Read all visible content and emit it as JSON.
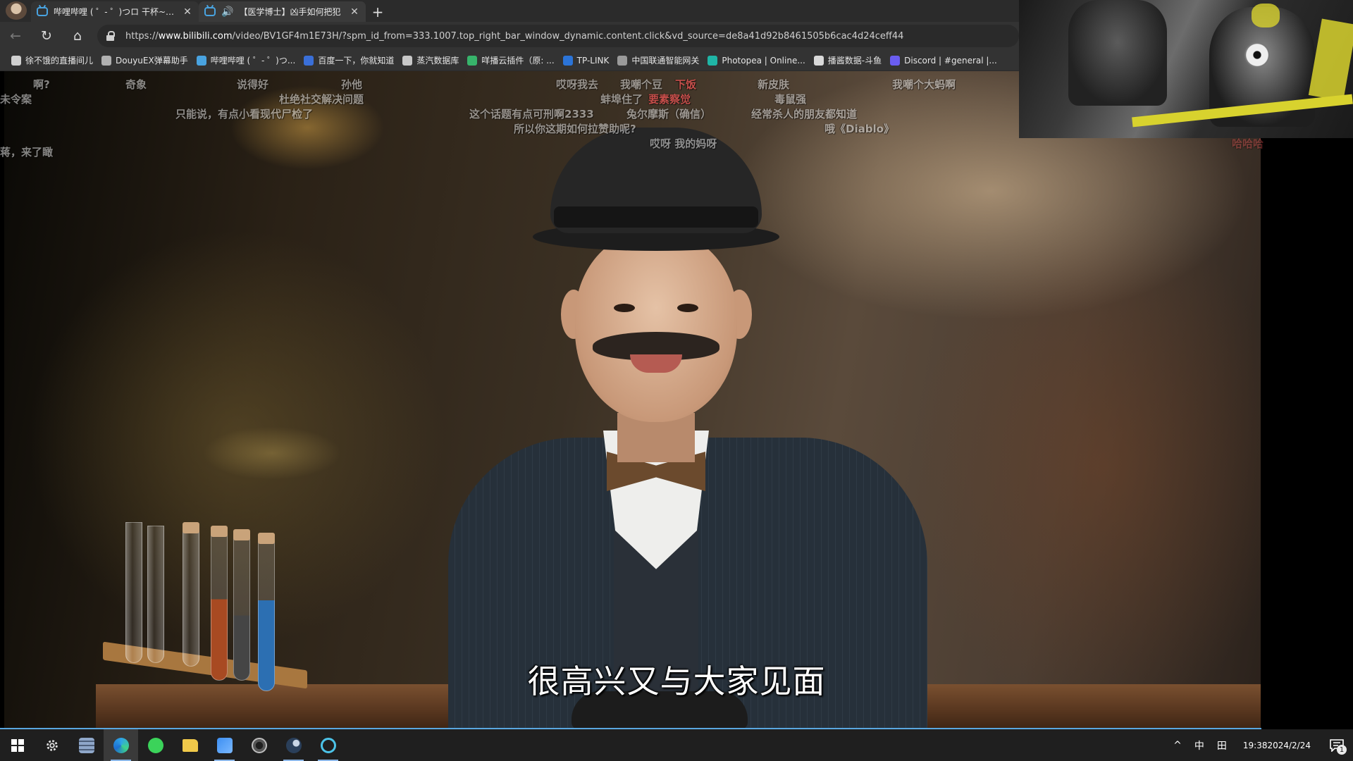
{
  "browser": {
    "tabs": [
      {
        "label": "哔哩哔哩 ( ゜- ゜)つロ 干杯~-bilil",
        "close": "✕"
      },
      {
        "label": "【医学博士】凶手如何把犯",
        "close": "✕"
      }
    ],
    "new_tab": "+",
    "icons": {
      "profile": "profile-avatar",
      "tab_favicon": "bilibili-tv-icon",
      "audio": "speaker-icon",
      "back": "arrow-left-icon",
      "reload": "reload-icon",
      "home": "home-icon",
      "lock": "lock-icon"
    },
    "nav": {
      "back": "←",
      "reload": "↻",
      "home": "⌂",
      "speaker": "🔊"
    },
    "url": {
      "scheme": "https://",
      "host": "www.bilibili.com",
      "path": "/video/BV1GF4m1E73H/?spm_id_from=333.1007.top_right_bar_window_dynamic.content.click&vd_source=de8a41d92b8461505b6cac4d24ceff44"
    },
    "bookmarks": [
      {
        "label": "徐不饿的直播间儿",
        "color": "#d0d0d0"
      },
      {
        "label": "DouyuEX弹幕助手",
        "color": "#b0b0b0"
      },
      {
        "label": "哔哩哔哩 ( ゜- ゜)つ...",
        "color": "#49a3e0"
      },
      {
        "label": "百度一下，你就知道",
        "color": "#3a6fd8"
      },
      {
        "label": "蒸汽数据库",
        "color": "#c8c8c8"
      },
      {
        "label": "咩播云插件（原: ...",
        "color": "#37b46b"
      },
      {
        "label": "TP-LINK",
        "color": "#2b74d8"
      },
      {
        "label": "中国联通智能网关",
        "color": "#9a9a9a"
      },
      {
        "label": "Photopea | Online...",
        "color": "#1fb5a6"
      },
      {
        "label": "播酱数据-斗鱼",
        "color": "#d9d9d9"
      },
      {
        "label": "Discord | #general |...",
        "color": "#6a5df0"
      }
    ]
  },
  "video": {
    "subtitle": "很高兴又与大家见面",
    "danmaku": [
      {
        "text": "啊?",
        "red": false
      },
      {
        "text": "奇象",
        "red": false
      },
      {
        "text": "说得好",
        "red": false
      },
      {
        "text": "孙他",
        "red": false
      },
      {
        "text": "哎呀我去",
        "red": false
      },
      {
        "text": "我嘲个豆",
        "red": false
      },
      {
        "text": "下饭",
        "red": true
      },
      {
        "text": "新皮肤",
        "red": false
      },
      {
        "text": "我嘲个大蚂啊",
        "red": false
      },
      {
        "text": "未令案",
        "red": false
      },
      {
        "text": "杜绝社交解决问题",
        "red": false
      },
      {
        "text": "蚌埠住了",
        "red": false
      },
      {
        "text": "要素察觉",
        "red": true
      },
      {
        "text": "毒鼠强",
        "red": false
      },
      {
        "text": "只能说，有点小看现代尸检了",
        "red": false
      },
      {
        "text": "这个话题有点可刑啊2333",
        "red": false
      },
      {
        "text": "兔尔摩斯（确信）",
        "red": false
      },
      {
        "text": "经常杀人的朋友都知道",
        "red": false
      },
      {
        "text": "所以你这期如何拉赞助呢?",
        "red": false
      },
      {
        "text": "哦《Diablo》",
        "red": false
      },
      {
        "text": "蒋，来了瞰",
        "red": false
      },
      {
        "text": "哎呀 我的妈呀",
        "red": false
      },
      {
        "text": "哈哈哈",
        "red": false
      }
    ]
  },
  "taskbar": {
    "apps": [
      {
        "name": "start-button",
        "color": "#ffffff"
      },
      {
        "name": "settings-gear-icon",
        "color": "#d0d0d0"
      },
      {
        "name": "calculator-icon",
        "color": "#8fa7c9"
      },
      {
        "name": "edge-browser-icon",
        "color": "#2fa4e7"
      },
      {
        "name": "xbox-icon",
        "color": "#3bd35a"
      },
      {
        "name": "file-explorer-icon",
        "color": "#f0c94a"
      },
      {
        "name": "feishu-icon",
        "color": "#3d8ff2"
      },
      {
        "name": "obs-studio-icon",
        "color": "#bdbdbd"
      },
      {
        "name": "steam-icon",
        "color": "#c9d6e6"
      },
      {
        "name": "ring-app-icon",
        "color": "#4cc3e8"
      }
    ],
    "tray": {
      "chevron": "^",
      "ime": "中",
      "ime_mode": "田",
      "time": "19:38",
      "date": "2024/2/24",
      "notification_count": "1"
    }
  }
}
